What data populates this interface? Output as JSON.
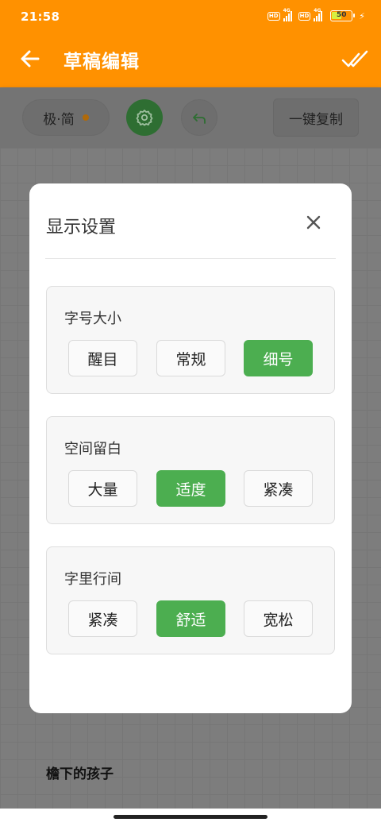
{
  "status_bar": {
    "time": "21:58",
    "hd1": "HD",
    "hd2": "HD",
    "net1": "4G",
    "net2": "4G",
    "battery": "50"
  },
  "header": {
    "title": "草稿编辑"
  },
  "toolbar": {
    "mode_label": "极·简",
    "copy_label": "一键复制"
  },
  "content": {
    "draft_title": "檐下的孩子"
  },
  "dialog": {
    "title": "显示设置",
    "sections": [
      {
        "label": "字号大小",
        "options": [
          "醒目",
          "常规",
          "细号"
        ],
        "selected_index": 2
      },
      {
        "label": "空间留白",
        "options": [
          "大量",
          "适度",
          "紧凑"
        ],
        "selected_index": 1
      },
      {
        "label": "字里行间",
        "options": [
          "紧凑",
          "舒适",
          "宽松"
        ],
        "selected_index": 1
      }
    ]
  },
  "colors": {
    "accent_orange": "#ff9100",
    "selected_green": "#4cae50"
  }
}
